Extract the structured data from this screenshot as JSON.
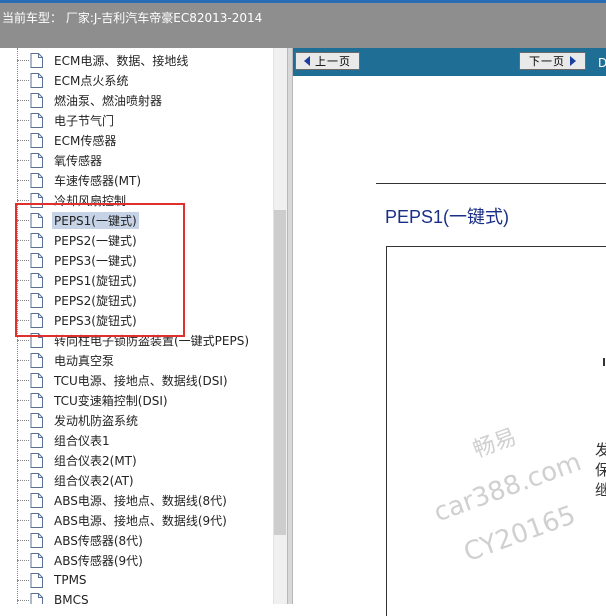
{
  "header": {
    "title": "当前车型： 厂家:J-吉利汽车帝豪EC82013-2014"
  },
  "tree": {
    "items": [
      {
        "label": "ECM电源、数据、接地线",
        "selected": false
      },
      {
        "label": "ECM点火系统",
        "selected": false
      },
      {
        "label": "燃油泵、燃油喷射器",
        "selected": false
      },
      {
        "label": "电子节气门",
        "selected": false
      },
      {
        "label": "ECM传感器",
        "selected": false
      },
      {
        "label": "氧传感器",
        "selected": false
      },
      {
        "label": "车速传感器(MT)",
        "selected": false
      },
      {
        "label": "冷却风扇控制",
        "selected": false
      },
      {
        "label": "PEPS1(一键式)",
        "selected": true
      },
      {
        "label": "PEPS2(一键式)",
        "selected": false
      },
      {
        "label": "PEPS3(一键式)",
        "selected": false
      },
      {
        "label": "PEPS1(旋钮式)",
        "selected": false
      },
      {
        "label": "PEPS2(旋钮式)",
        "selected": false
      },
      {
        "label": "PEPS3(旋钮式)",
        "selected": false
      },
      {
        "label": "转向柱电子锁防盗装置(一键式PEPS)",
        "selected": false
      },
      {
        "label": "电动真空泵",
        "selected": false
      },
      {
        "label": "TCU电源、接地点、数据线(DSI)",
        "selected": false
      },
      {
        "label": "TCU变速箱控制(DSI)",
        "selected": false
      },
      {
        "label": "发动机防盗系统",
        "selected": false
      },
      {
        "label": "组合仪表1",
        "selected": false
      },
      {
        "label": "组合仪表2(MT)",
        "selected": false
      },
      {
        "label": "组合仪表2(AT)",
        "selected": false
      },
      {
        "label": "ABS电源、接地点、数据线(8代)",
        "selected": false
      },
      {
        "label": "ABS电源、接地点、数据线(9代)",
        "selected": false
      },
      {
        "label": "ABS传感器(8代)",
        "selected": false
      },
      {
        "label": "ABS传感器(9代)",
        "selected": false
      },
      {
        "label": "TPMS",
        "selected": false
      },
      {
        "label": "BMCS",
        "selected": false
      }
    ]
  },
  "nav": {
    "prev_label": "上一页",
    "next_label": "下一页",
    "extra": "D"
  },
  "document": {
    "title": "PEPS1(一键式)",
    "diagram_text": "发\n保\n继"
  },
  "watermark": {
    "line1": "畅易",
    "line2": "car388.com",
    "line3": "CY20165"
  },
  "colors": {
    "header_bg": "#8e8e8e",
    "nav_bg": "#1f6e95",
    "highlight_border": "#e0302e",
    "selected_bg": "#c6d3e6",
    "doc_title": "#1a2f87"
  }
}
